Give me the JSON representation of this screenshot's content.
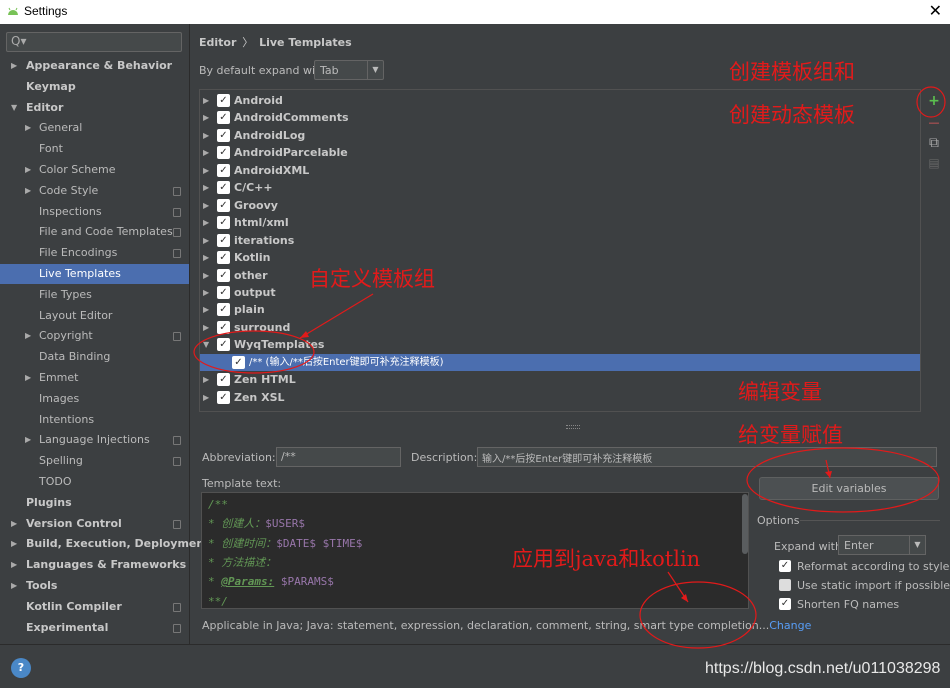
{
  "window": {
    "title": "Settings",
    "close_glyph": "✕"
  },
  "search": {
    "placeholder": "Q▾"
  },
  "sidebar": {
    "items": [
      {
        "label": "Appearance & Behavior",
        "arrow": "▶",
        "bold": true
      },
      {
        "label": "Keymap",
        "bold": true
      },
      {
        "label": "Editor",
        "arrow": "▼",
        "bold": true
      },
      {
        "label": "General",
        "arrow": "▶"
      },
      {
        "label": "Font"
      },
      {
        "label": "Color Scheme",
        "arrow": "▶"
      },
      {
        "label": "Code Style",
        "arrow": "▶",
        "project": true
      },
      {
        "label": "Inspections",
        "project": true
      },
      {
        "label": "File and Code Templates",
        "project": true
      },
      {
        "label": "File Encodings",
        "project": true
      },
      {
        "label": "Live Templates",
        "selected": true
      },
      {
        "label": "File Types"
      },
      {
        "label": "Layout Editor"
      },
      {
        "label": "Copyright",
        "arrow": "▶",
        "project": true
      },
      {
        "label": "Data Binding"
      },
      {
        "label": "Emmet",
        "arrow": "▶"
      },
      {
        "label": "Images"
      },
      {
        "label": "Intentions"
      },
      {
        "label": "Language Injections",
        "arrow": "▶",
        "project": true
      },
      {
        "label": "Spelling",
        "project": true
      },
      {
        "label": "TODO"
      },
      {
        "label": "Plugins",
        "bold": true
      },
      {
        "label": "Version Control",
        "arrow": "▶",
        "bold": true,
        "project": true
      },
      {
        "label": "Build, Execution, Deployment",
        "arrow": "▶",
        "bold": true
      },
      {
        "label": "Languages & Frameworks",
        "arrow": "▶",
        "bold": true
      },
      {
        "label": "Tools",
        "arrow": "▶",
        "bold": true
      },
      {
        "label": "Kotlin Compiler",
        "bold": true,
        "project": true
      },
      {
        "label": "Experimental",
        "bold": true,
        "project": true
      }
    ]
  },
  "breadcrumb": {
    "section": "Editor",
    "sep": "〉",
    "page": "Live Templates"
  },
  "expand": {
    "label": "By default expand with",
    "value": "Tab"
  },
  "groups": [
    {
      "label": "Android",
      "arrow": "▶",
      "checked": true
    },
    {
      "label": "AndroidComments",
      "arrow": "▶",
      "checked": true
    },
    {
      "label": "AndroidLog",
      "arrow": "▶",
      "checked": true
    },
    {
      "label": "AndroidParcelable",
      "arrow": "▶",
      "checked": true
    },
    {
      "label": "AndroidXML",
      "arrow": "▶",
      "checked": true
    },
    {
      "label": "C/C++",
      "arrow": "▶",
      "checked": true
    },
    {
      "label": "Groovy",
      "arrow": "▶",
      "checked": true
    },
    {
      "label": "html/xml",
      "arrow": "▶",
      "checked": true
    },
    {
      "label": "iterations",
      "arrow": "▶",
      "checked": true
    },
    {
      "label": "Kotlin",
      "arrow": "▶",
      "checked": true
    },
    {
      "label": "other",
      "arrow": "▶",
      "checked": true
    },
    {
      "label": "output",
      "arrow": "▶",
      "checked": true
    },
    {
      "label": "plain",
      "arrow": "▶",
      "checked": true
    },
    {
      "label": "surround",
      "arrow": "▶",
      "checked": true
    },
    {
      "label": "WyqTemplates",
      "arrow": "▼",
      "checked": true
    },
    {
      "label": "/** (输入/**后按Enter键即可补充注释模板)",
      "child": true,
      "selected": true,
      "checked": true
    },
    {
      "label": "Zen HTML",
      "arrow": "▶",
      "checked": true
    },
    {
      "label": "Zen XSL",
      "arrow": "▶",
      "checked": true
    }
  ],
  "tools": {
    "add": "+",
    "remove": "—",
    "copy": "⧉",
    "restore": "▤"
  },
  "abbreviation": {
    "label": "Abbreviation:",
    "value": "/**"
  },
  "description": {
    "label": "Description:",
    "value": "输入/**后按Enter键即可补充注释模板"
  },
  "template_text": {
    "label": "Template text:",
    "lines": [
      {
        "text": "/**"
      },
      {
        "text": " * 创建人：",
        "var": "$USER$"
      },
      {
        "text": " * 创建时间：",
        "var": "$DATE$ $TIME$"
      },
      {
        "text": " * 方法描述："
      },
      {
        "text": " * ",
        "tag": "@Params:",
        "var": " $PARAMS$"
      },
      {
        "text": " **/"
      }
    ]
  },
  "applicable": {
    "text": "Applicable in Java; Java: statement, expression, declaration, comment, string, smart type completion...",
    "link": "Change"
  },
  "edit_variables": "Edit variables",
  "options": {
    "title": "Options",
    "expand_label": "Expand with",
    "expand_value": "Enter",
    "reformat": {
      "label": "Reformat according to style",
      "checked": true
    },
    "static_import": {
      "label": "Use static import if possible",
      "checked": false
    },
    "shorten_fq": {
      "label": "Shorten FQ names",
      "checked": true
    }
  },
  "help": "?",
  "watermark": "https://blog.csdn.net/u011038298",
  "annotations": {
    "create_line1": "创建模板组和",
    "create_line2": "创建动态模板",
    "custom_group": "自定义模板组",
    "edit_vars_line1": "编辑变量",
    "edit_vars_line2": "给变量赋值",
    "apply_to": "应用到java和kotlin",
    "color": "#e21a1a"
  }
}
